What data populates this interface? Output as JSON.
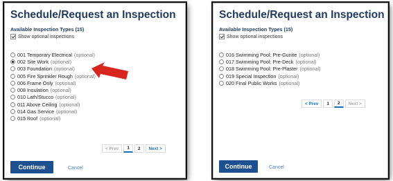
{
  "left": {
    "title": "Schedule/Request an Inspection",
    "subtitle": "Available Inspection Types (15)",
    "show_optional_label": "Show optional inspections",
    "items": [
      {
        "name": "001 Temporary Electrical",
        "opt": "(optional)"
      },
      {
        "name": "002 Site Work",
        "opt": "(optional)"
      },
      {
        "name": "003 Foundation",
        "opt": "(optional)"
      },
      {
        "name": "005 Fire Sprinkler Rough",
        "opt": "(optional)"
      },
      {
        "name": "006 Frame Only",
        "opt": "(optional)"
      },
      {
        "name": "008 Insulation",
        "opt": "(optional)"
      },
      {
        "name": "010 Lath/Stucco",
        "opt": "(optional)"
      },
      {
        "name": "011 Above Ceiling",
        "opt": "(optional)"
      },
      {
        "name": "014 Gas Service",
        "opt": "(optional)"
      },
      {
        "name": "015 Roof",
        "opt": "(optional)"
      }
    ],
    "selected_item": "002 Site Work",
    "pager": {
      "prev": "< Prev",
      "page1": "1",
      "page2": "2",
      "next": "Next >"
    },
    "continue_label": "Continue",
    "cancel_label": "Cancel"
  },
  "right": {
    "title": "Schedule/Request an Inspection",
    "subtitle": "Available Inspection Types (15)",
    "show_optional_label": "Show optional inspections",
    "items": [
      {
        "name": "016 Swimming Pool: Pre-Gunite",
        "opt": "(optional)"
      },
      {
        "name": "017 Swimming Pool: Pre-Deck",
        "opt": "(optional)"
      },
      {
        "name": "018 Swimming Pool: Pre-Plaster",
        "opt": "(optional)"
      },
      {
        "name": "019 Special Inspection",
        "opt": "(optional)"
      },
      {
        "name": "020 Final Public Works",
        "opt": "(optional)"
      }
    ],
    "pager": {
      "prev": "< Prev",
      "page1": "1",
      "page2": "2",
      "next": "Next >"
    },
    "continue_label": "Continue",
    "cancel_label": "Cancel"
  },
  "colors": {
    "title": "#1f3a5f",
    "primary_button": "#1d4f91",
    "link": "#3a7fc2",
    "arrow": "#d6261e"
  },
  "icons": {
    "annotation": "red-arrow-icon"
  }
}
